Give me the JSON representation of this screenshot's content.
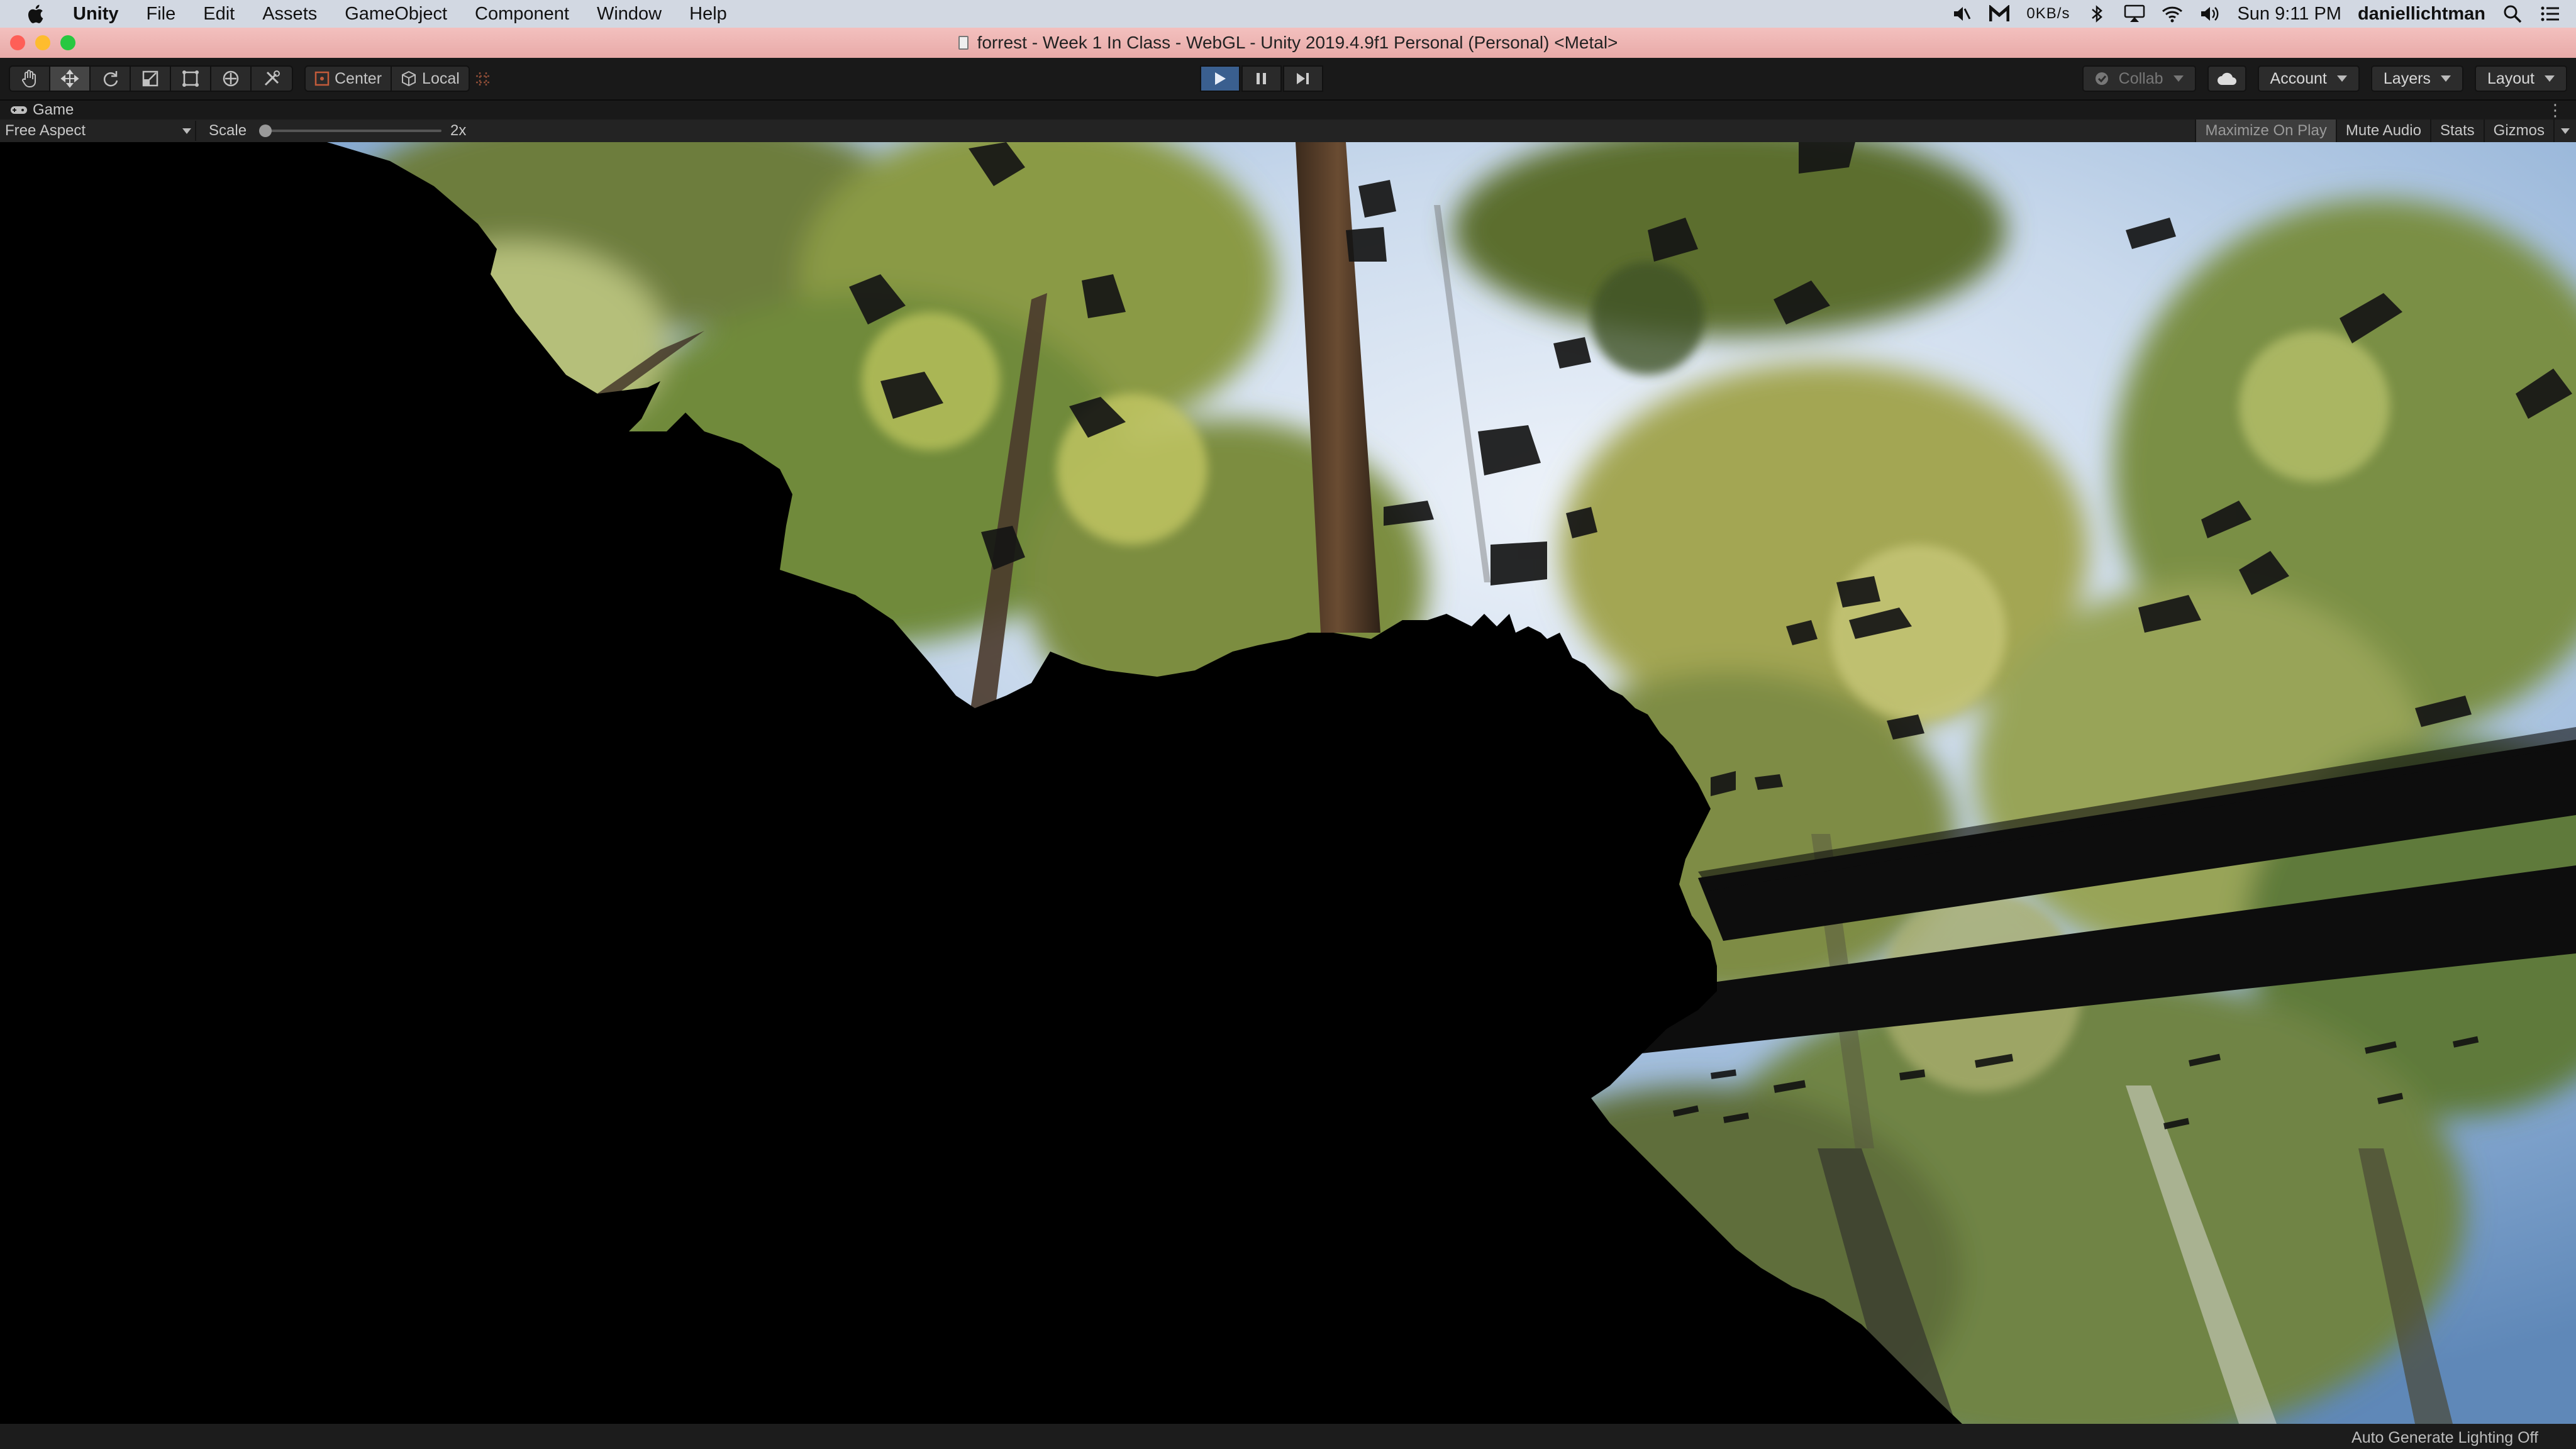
{
  "menubar": {
    "app_name": "Unity",
    "items": [
      "File",
      "Edit",
      "Assets",
      "GameObject",
      "Component",
      "Window",
      "Help"
    ],
    "net_speed": "0KB/s",
    "clock": "Sun 9:11 PM",
    "user": "daniellichtman",
    "icons": [
      "apple-logo",
      "speaker-slash-icon",
      "m-app-icon",
      "bluetooth-icon",
      "airplay-icon",
      "wifi-icon",
      "volume-icon",
      "spotlight-search-icon",
      "control-center-icon"
    ]
  },
  "window": {
    "title": "forrest - Week 1 In Class - WebGL - Unity 2019.4.9f1 Personal (Personal) <Metal>",
    "traffic_lights": {
      "close": "#fe5f57",
      "minimize": "#febc2e",
      "zoom": "#28c840"
    }
  },
  "toolbar": {
    "transform_tools": [
      "hand-tool-icon",
      "move-tool-icon",
      "rotate-tool-icon",
      "scale-tool-icon",
      "rect-tool-icon",
      "transform-tool-icon",
      "custom-tool-icon"
    ],
    "pivot_center": "Center",
    "pivot_local": "Local",
    "collab": "Collab",
    "account": "Account",
    "layers": "Layers",
    "layout": "Layout",
    "play_accent": "#3a5f8f"
  },
  "game_view": {
    "tab_label": "Game",
    "aspect": "Free Aspect",
    "scale_label": "Scale",
    "scale_value": "2x",
    "maximize_on_play": "Maximize On Play",
    "mute_audio": "Mute Audio",
    "stats": "Stats",
    "gizmos": "Gizmos"
  },
  "status": {
    "lighting": "Auto Generate Lighting Off"
  }
}
